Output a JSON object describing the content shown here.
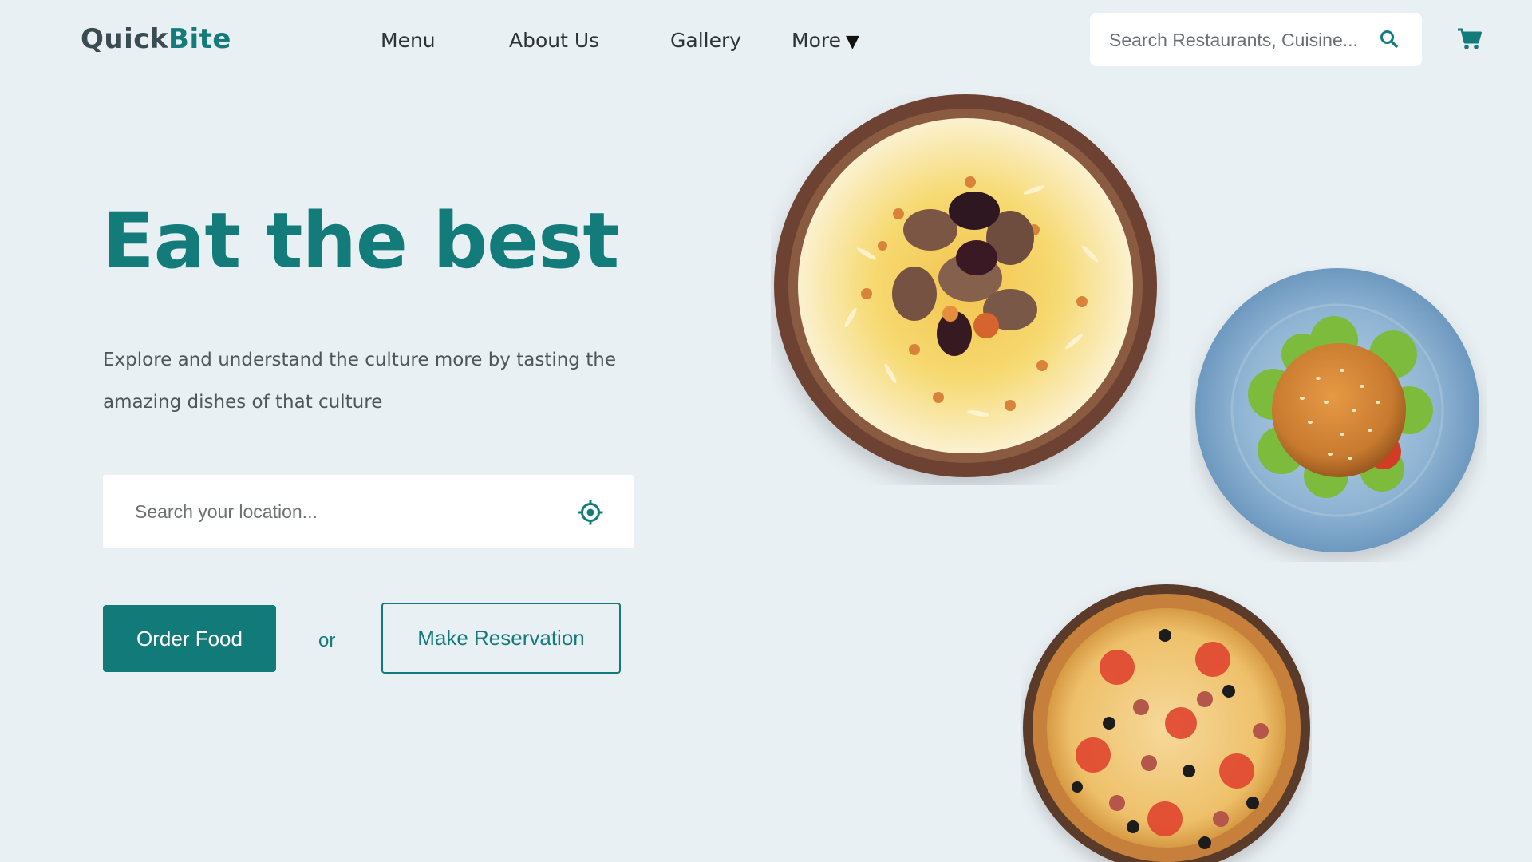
{
  "brand": {
    "part1": "Quick",
    "part2": "Bite"
  },
  "nav": {
    "menu": "Menu",
    "about": "About Us",
    "gallery": "Gallery",
    "more": "More",
    "more_caret": "▼"
  },
  "search": {
    "placeholder": "Search Restaurants, Cuisine..."
  },
  "hero": {
    "title": "Eat the best",
    "subtitle": "Explore and understand the culture more by tasting the amazing dishes of that culture"
  },
  "location": {
    "placeholder": "Search your location..."
  },
  "actions": {
    "order": "Order Food",
    "or": "or",
    "reserve": "Make Reservation"
  },
  "colors": {
    "brand_teal": "#137c7a",
    "background": "#e9f0f4"
  },
  "icons": [
    "search-icon",
    "cart-icon",
    "location-target-icon"
  ],
  "dishes": [
    "rice-pilaf-plate",
    "burger-plate",
    "pizza"
  ]
}
